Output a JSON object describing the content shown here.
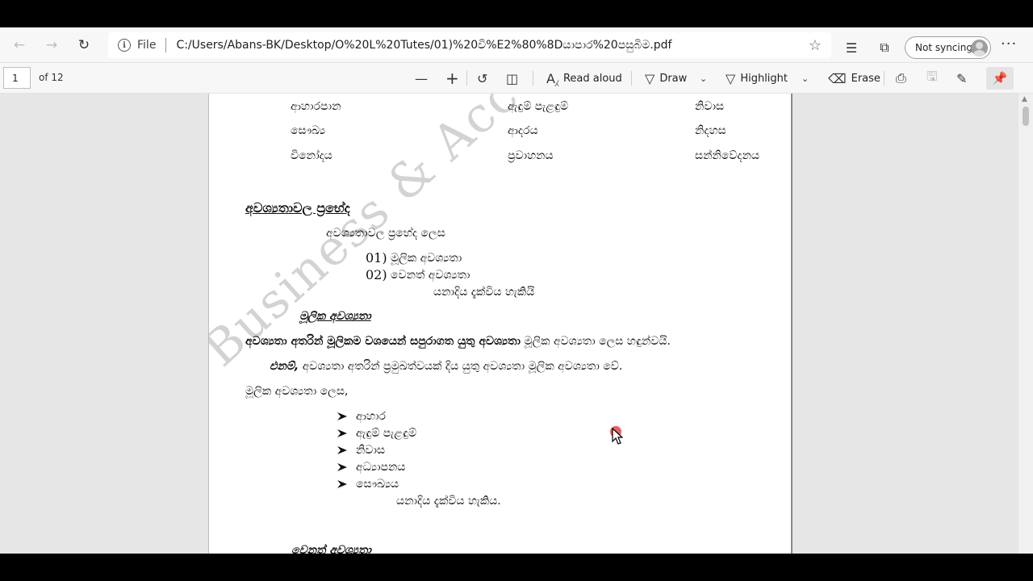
{
  "browser": {
    "file_label": "File",
    "url": "C:/Users/Abans-BK/Desktop/O%20L%20Tutes/01)%20වි%E2%80%8Dයාපාර%20පසුබිම.pdf",
    "sync_label": "Not syncing",
    "more_label": "···"
  },
  "pdf_toolbar": {
    "page_number": "1",
    "page_count": "of 12",
    "read_aloud": "Read aloud",
    "draw": "Draw",
    "highlight": "Highlight",
    "erase": "Erase"
  },
  "document": {
    "watermark": "Business & Accounting Studies",
    "table": [
      [
        "ආහාරපාන",
        "ඇඳුම් පැළඳුම්",
        "නිවාස"
      ],
      [
        "සෞඛ්‍ය",
        "ආදරය",
        "නිදහස"
      ],
      [
        "විනෝදය",
        "ප්‍රවාහනය",
        "සන්නිවේදනය"
      ]
    ],
    "heading_types": "අවශ්‍යතාවල ප්‍රභේද",
    "types_intro": "අවශ්‍යතාවල ප්‍රභේද ලෙස",
    "type_1_num": "01)",
    "type_1": "මූලික අවශ්‍යතා",
    "type_2_num": "02)",
    "type_2": "වෙනත් අවශ්‍යතා",
    "types_tail": "යනාදිය දැක්විය හැකියි",
    "heading_basic": "මූලික අවශ්‍යතා",
    "def_bold": "අවශ්‍යතා අතරින් මූලිකම වශයෙන් සපුරාගත යුතු අවශ්‍යතා",
    "def_rest": "මූලික අවශ්‍යතා ලෙස හඳුන්වයි.",
    "so_bold": "එනම්,",
    "so_rest": "අවශ්‍යතා අතරින් ප්‍රමුඛත්වයක් දිය යුතු අවශ්‍යතා මූලික අවශ්‍යතා වේ.",
    "list_intro": "මූලික අවශ්‍යතා ලෙස,",
    "basic_needs": [
      "ආහාර",
      "ඇඳුම් පැළඳුම්",
      "නිවාස",
      "අධ්‍යාපනය",
      "සෞඛ්‍යය"
    ],
    "list_tail": "යනාදිය දැක්විය හැකිය.",
    "heading_other": "වෙනත් අවශ්‍යතා"
  }
}
